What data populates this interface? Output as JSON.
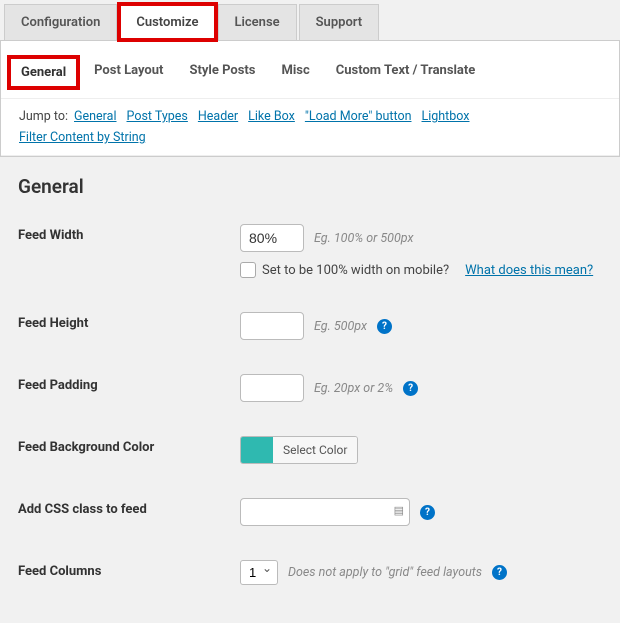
{
  "tabs_primary": {
    "configuration": "Configuration",
    "customize": "Customize",
    "license": "License",
    "support": "Support"
  },
  "tabs_secondary": {
    "general": "General",
    "post_layout": "Post Layout",
    "style_posts": "Style Posts",
    "misc": "Misc",
    "custom_text": "Custom Text / Translate"
  },
  "jumpto": {
    "label": "Jump to:",
    "links": {
      "general": "General",
      "post_types": "Post Types",
      "header": "Header",
      "like_box": "Like Box",
      "load_more": "\"Load More\" button",
      "lightbox": "Lightbox",
      "filter": "Filter Content by String"
    }
  },
  "section_title": "General",
  "fields": {
    "feed_width": {
      "label": "Feed Width",
      "value": "80%",
      "hint": "Eg. 100% or 500px",
      "checkbox_label": "Set to be 100% width on mobile?",
      "help_link": "What does this mean?"
    },
    "feed_height": {
      "label": "Feed Height",
      "value": "",
      "hint": "Eg. 500px"
    },
    "feed_padding": {
      "label": "Feed Padding",
      "value": "",
      "hint": "Eg. 20px or 2%"
    },
    "feed_bg": {
      "label": "Feed Background Color",
      "button": "Select Color",
      "swatch": "#2fb9b0"
    },
    "css_class": {
      "label": "Add CSS class to feed",
      "value": ""
    },
    "feed_columns": {
      "label": "Feed Columns",
      "value": "1",
      "hint": "Does not apply to \"grid\" feed layouts"
    }
  }
}
